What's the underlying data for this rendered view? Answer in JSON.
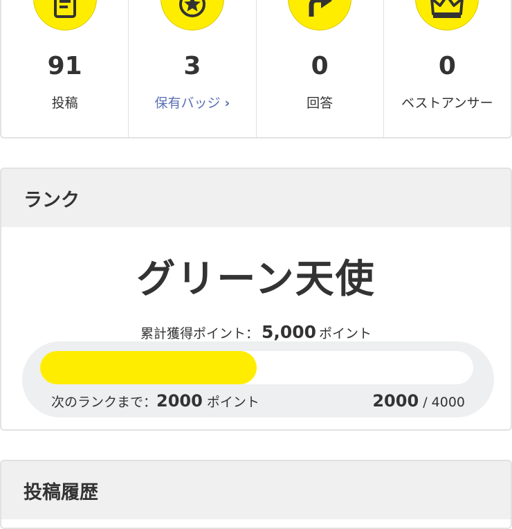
{
  "stats": [
    {
      "icon": "document-icon",
      "value": "91",
      "label": "投稿"
    },
    {
      "icon": "star-badge-icon",
      "value": "3",
      "label": "保有バッジ",
      "link": true
    },
    {
      "icon": "reply-arrow-icon",
      "value": "0",
      "label": "回答"
    },
    {
      "icon": "crown-icon",
      "value": "0",
      "label": "ベストアンサー"
    }
  ],
  "rank": {
    "header": "ランク",
    "name": "グリーン天使",
    "points_prefix": "累計獲得ポイント：",
    "points_value": "5,000",
    "points_unit": "ポイント",
    "progress_fraction": 0.5,
    "next_prefix": "次のランクまで：",
    "next_value": "2000",
    "next_unit": "ポイント",
    "current": "2000",
    "separator": "/",
    "max": "4000"
  },
  "history": {
    "header": "投稿履歴"
  },
  "colors": {
    "accent_yellow": "#ffed00",
    "link_blue": "#5a6fb5"
  }
}
